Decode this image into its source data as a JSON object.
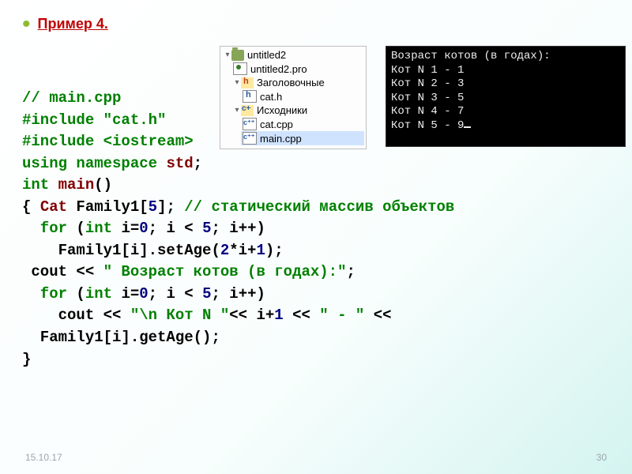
{
  "title": "Пример 4.",
  "code": {
    "l1_comment": "// main.cpp",
    "l2_a": "#include ",
    "l2_b": "\"cat.h\"",
    "l3_a": "#include ",
    "l3_b": "<iostream>",
    "l4_a": "using ",
    "l4_b": "namespace ",
    "l4_c": "std",
    "l4_d": ";",
    "l5_a": "int ",
    "l5_b": "main",
    "l5_c": "()",
    "l6_a": "{ ",
    "l6_b": "Cat",
    "l6_c": " Family1[",
    "l6_d": "5",
    "l6_e": "]; ",
    "l6_f": "// статический массив объектов",
    "l7_a": "  for ",
    "l7_b": "(",
    "l7_c": "int ",
    "l7_d": "i=",
    "l7_e": "0",
    "l7_f": "; i < ",
    "l7_g": "5",
    "l7_h": "; i++)",
    "l8_a": "    Family1[i].setAge(",
    "l8_b": "2",
    "l8_c": "*i+",
    "l8_d": "1",
    "l8_e": ");",
    "l9_a": " cout << ",
    "l9_b": "\" Возраст котов (в годах):\"",
    "l9_c": ";",
    "l10_a": "  for ",
    "l10_b": "(",
    "l10_c": "int ",
    "l10_d": "i=",
    "l10_e": "0",
    "l10_f": "; i < ",
    "l10_g": "5",
    "l10_h": "; i++)",
    "l11_a": "    cout << ",
    "l11_b": "\"\\n Кот N \"",
    "l11_c": "<< i+",
    "l11_d": "1",
    "l11_e": " << ",
    "l11_f": "\" - \"",
    "l11_g": " <<",
    "l11h": "  Family1[i].getAge();",
    "l12": "}"
  },
  "tree": {
    "root": "untitled2",
    "pro": "untitled2.pro",
    "hdr_folder": "Заголовочные",
    "hdr_file": "cat.h",
    "src_folder": "Исходники",
    "src1": "cat.cpp",
    "src2": "main.cpp"
  },
  "console": {
    "l0": "Возраст котов (в годах):",
    "l1": "Кот N 1 - 1",
    "l2": "Кот N 2 - 3",
    "l3": "Кот N 3 - 5",
    "l4": "Кот N 4 - 7",
    "l5": "Кот N 5 - 9"
  },
  "footer": {
    "date": "15.10.17",
    "page": "30"
  }
}
